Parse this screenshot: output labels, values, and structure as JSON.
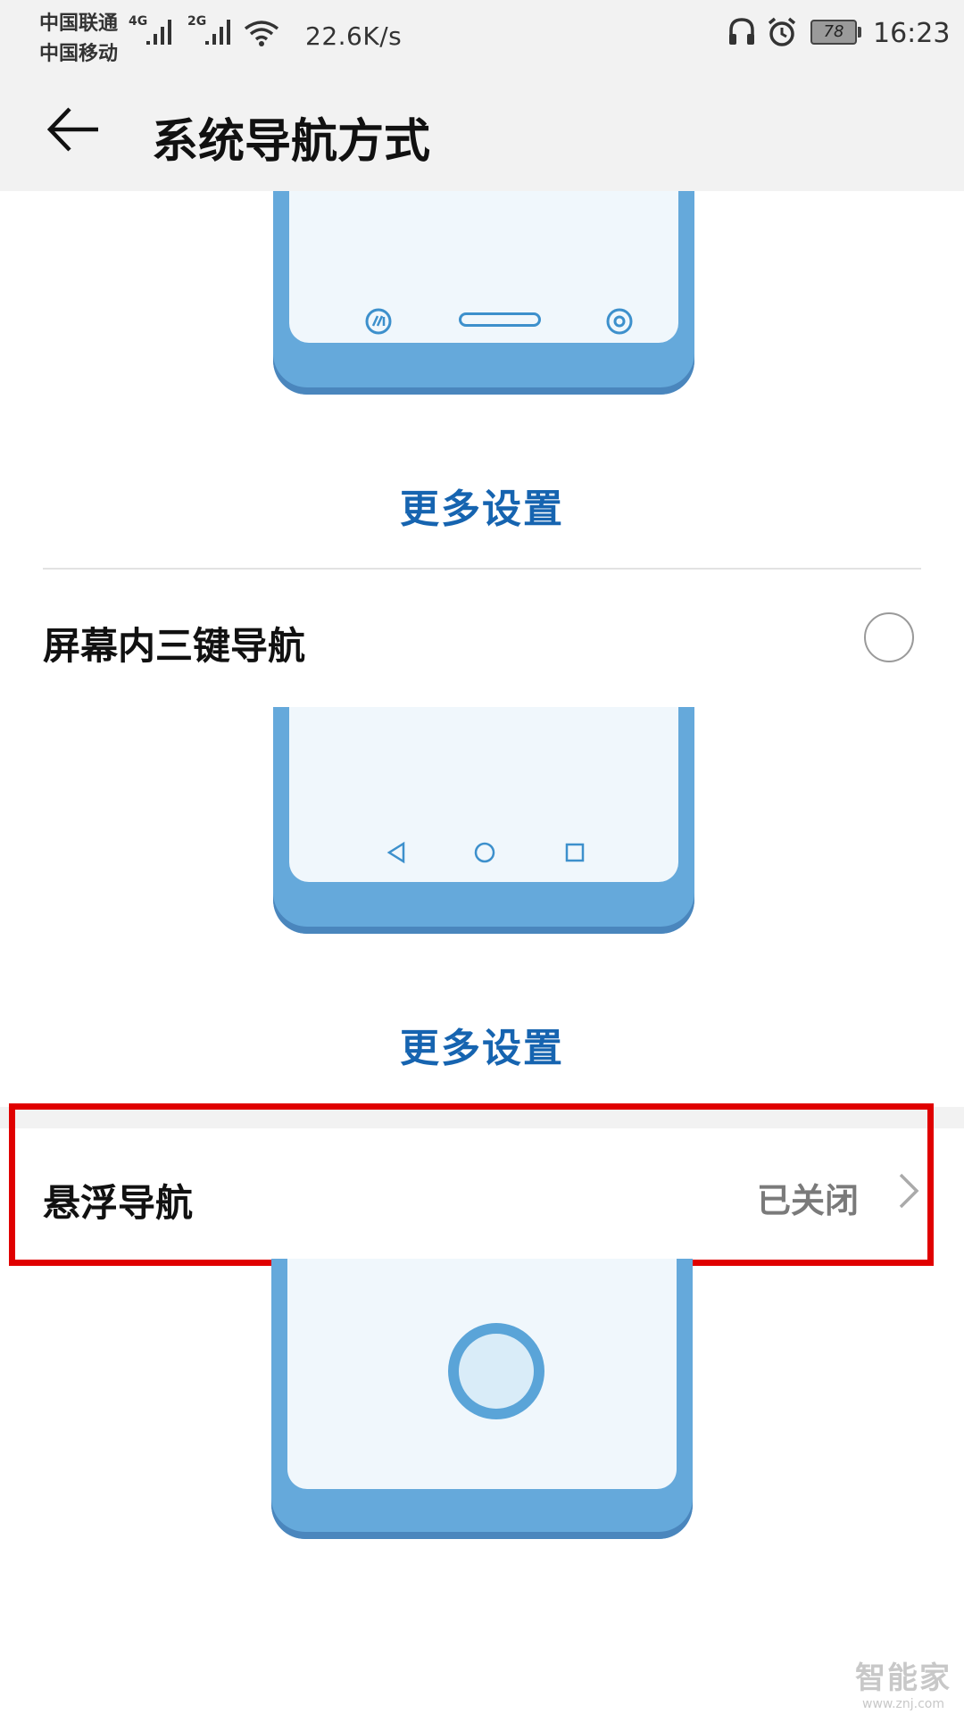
{
  "status_bar": {
    "carrier1": "中国联通",
    "carrier2": "中国移动",
    "net1": "4G",
    "net2": "2G",
    "speed": "22.6K/s",
    "battery": "78",
    "time": "16:23"
  },
  "header": {
    "title": "系统导航方式"
  },
  "options": {
    "gesture_more": "更多设置",
    "three_key": {
      "label": "屏幕内三键导航",
      "selected": false,
      "more": "更多设置"
    },
    "float_nav": {
      "label": "悬浮导航",
      "status": "已关闭"
    }
  },
  "watermark": {
    "main": "智能家",
    "sub": "www.znj.com"
  },
  "colors": {
    "accent": "#1664b0",
    "phone_body": "#65a9db",
    "phone_screen": "#f0f7fc",
    "highlight": "#e00000"
  },
  "icons": [
    "back-arrow-icon",
    "headset-icon",
    "alarm-clock-icon",
    "wifi-icon",
    "signal-icon",
    "chevron-right-icon"
  ]
}
